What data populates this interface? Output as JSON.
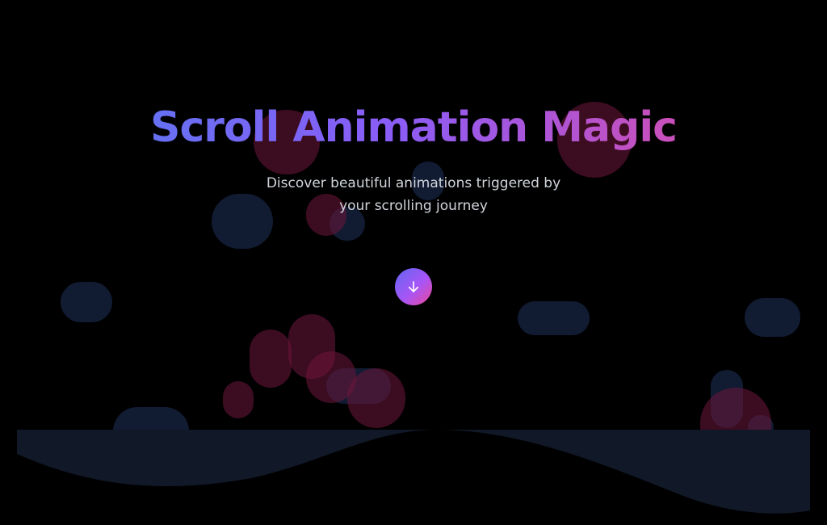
{
  "hero": {
    "title": "Scroll Animation Magic",
    "subtitle": "Discover beautiful animations triggered by your scrolling journey"
  },
  "scroll_button": {
    "icon": "arrow-down-icon"
  },
  "colors": {
    "background": "#000000",
    "title_gradient_start": "#4f7cf0",
    "title_gradient_mid": "#8b5cf6",
    "title_gradient_end": "#ec4899",
    "subtitle": "#d1d5db",
    "wave_band": "#111827",
    "blob_blue": "#182848",
    "blob_pink": "#6e163a"
  }
}
